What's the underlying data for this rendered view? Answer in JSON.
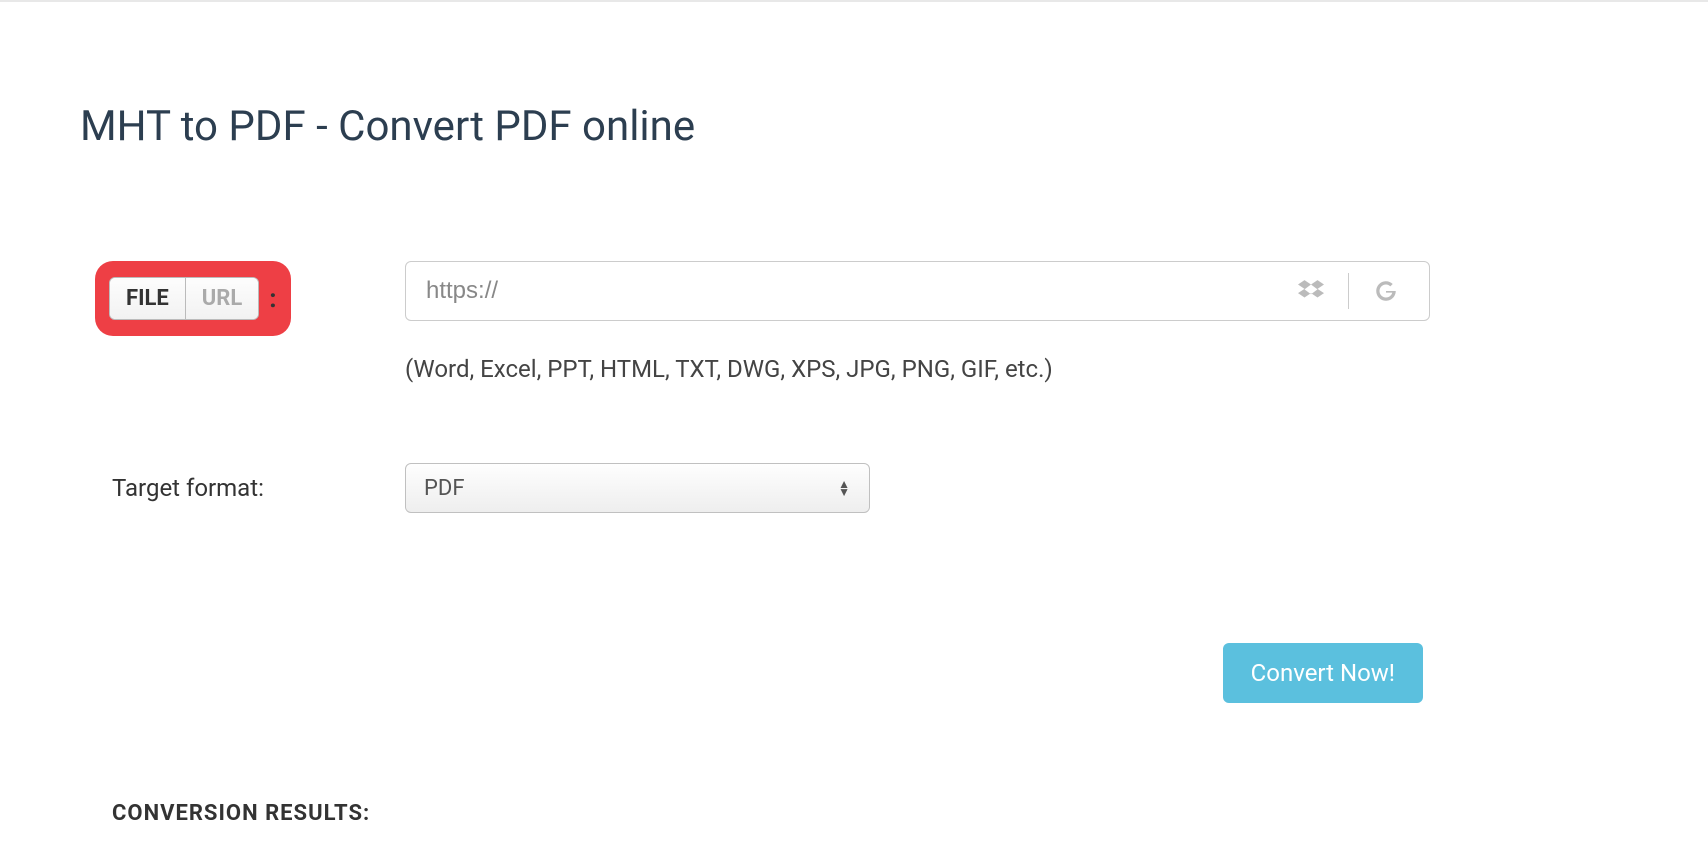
{
  "page_title": "MHT to PDF - Convert PDF online",
  "source_toggle": {
    "file_label": "FILE",
    "url_label": "URL",
    "colon": ":"
  },
  "url_input": {
    "placeholder": "https://"
  },
  "hint_text": "(Word, Excel, PPT, HTML, TXT, DWG, XPS, JPG, PNG, GIF, etc.)",
  "target_format_label": "Target format:",
  "target_format_value": "PDF",
  "convert_button_label": "Convert Now!",
  "results_heading": "CONVERSION RESULTS:"
}
